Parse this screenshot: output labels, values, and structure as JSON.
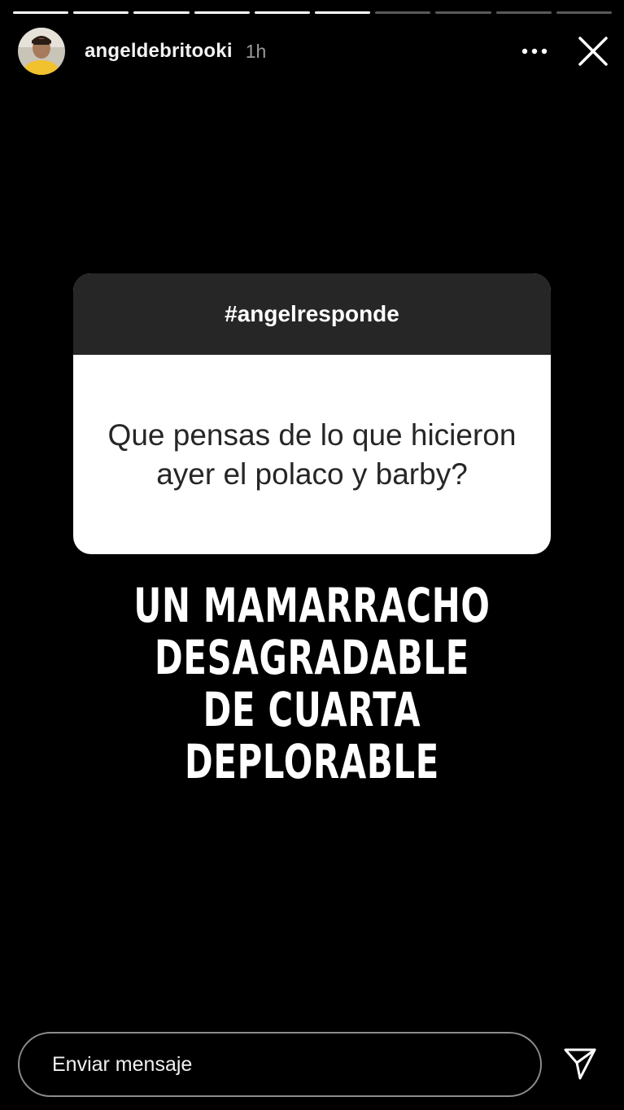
{
  "story": {
    "segments": [
      {
        "progress": 1.0
      },
      {
        "progress": 1.0
      },
      {
        "progress": 1.0
      },
      {
        "progress": 1.0
      },
      {
        "progress": 1.0
      },
      {
        "progress": 1.0
      },
      {
        "progress": 0.0
      },
      {
        "progress": 0.0
      },
      {
        "progress": 0.0
      },
      {
        "progress": 0.0
      }
    ]
  },
  "header": {
    "username": "angeldebritooki",
    "time": "1h",
    "avatar_icon": "profile-avatar",
    "more_icon": "more-horizontal-icon",
    "close_icon": "close-icon"
  },
  "question_sticker": {
    "title": "#angelresponde",
    "question": "Que pensas de lo que hicieron ayer el polaco y barby?"
  },
  "answer": {
    "lines": [
      "UN MAMARRACHO",
      "DESAGRADABLE",
      "DE CUARTA",
      "DEPLORABLE"
    ]
  },
  "reply": {
    "placeholder": "Enviar mensaje",
    "send_icon": "send-icon"
  },
  "colors": {
    "background": "#000000",
    "card_header": "#262626",
    "card_body": "#ffffff",
    "card_text": "#262626"
  }
}
